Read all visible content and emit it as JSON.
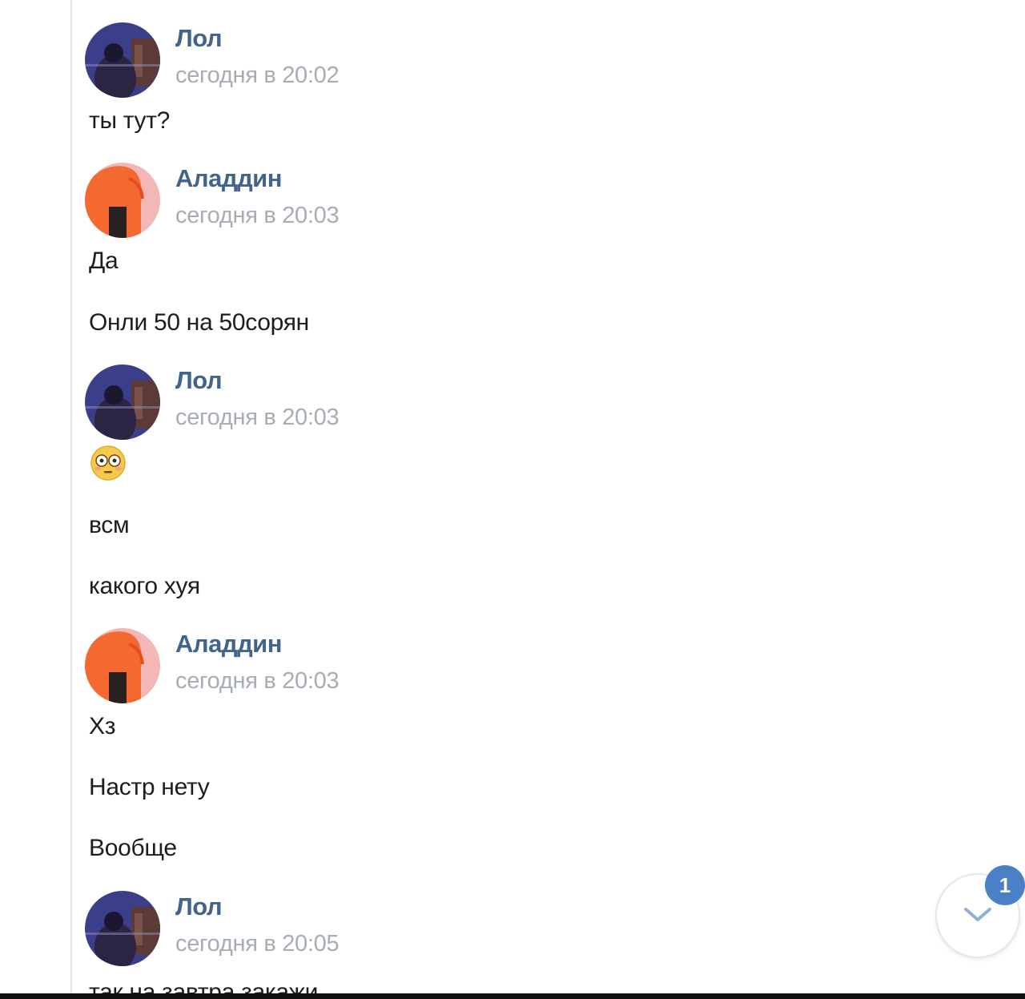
{
  "messages": [
    {
      "author": "Лол",
      "time": "сегодня в 20:02",
      "avatar": "lol-avatar",
      "lines": [
        "ты тут?"
      ]
    },
    {
      "author": "Аладдин",
      "time": "сегодня в 20:03",
      "avatar": "aladdin-avatar",
      "lines": [
        "Да",
        "Онли 50 на 50сорян"
      ]
    },
    {
      "author": "Лол",
      "time": "сегодня в 20:03",
      "avatar": "lol-avatar",
      "emoji": "flushed-face-emoji",
      "lines": [
        "всм",
        "какого хуя"
      ]
    },
    {
      "author": "Аладдин",
      "time": "сегодня в 20:03",
      "avatar": "aladdin-avatar",
      "lines": [
        "Хз",
        "Настр нету",
        "Вообще"
      ]
    },
    {
      "author": "Лол",
      "time": "сегодня в 20:05",
      "avatar": "lol-avatar",
      "lines": [
        "так на завтра закажи"
      ]
    }
  ],
  "scroll_down": {
    "icon": "chevron-down-icon",
    "unread_count": "1"
  },
  "colors": {
    "author": "#42648b",
    "time": "#a6adb5",
    "badge": "#4a80c6"
  }
}
